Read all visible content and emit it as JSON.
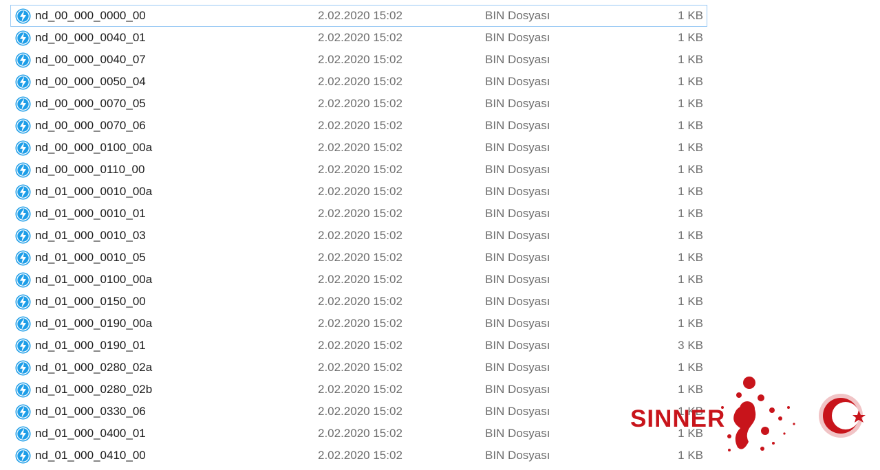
{
  "file_list": {
    "selected_index": 0,
    "file_icon": "lightning-file-icon",
    "rows": [
      {
        "name": "nd_00_000_0000_00",
        "date": "2.02.2020 15:02",
        "type": "BIN Dosyası",
        "size": "1 KB"
      },
      {
        "name": "nd_00_000_0040_01",
        "date": "2.02.2020 15:02",
        "type": "BIN Dosyası",
        "size": "1 KB"
      },
      {
        "name": "nd_00_000_0040_07",
        "date": "2.02.2020 15:02",
        "type": "BIN Dosyası",
        "size": "1 KB"
      },
      {
        "name": "nd_00_000_0050_04",
        "date": "2.02.2020 15:02",
        "type": "BIN Dosyası",
        "size": "1 KB"
      },
      {
        "name": "nd_00_000_0070_05",
        "date": "2.02.2020 15:02",
        "type": "BIN Dosyası",
        "size": "1 KB"
      },
      {
        "name": "nd_00_000_0070_06",
        "date": "2.02.2020 15:02",
        "type": "BIN Dosyası",
        "size": "1 KB"
      },
      {
        "name": "nd_00_000_0100_00a",
        "date": "2.02.2020 15:02",
        "type": "BIN Dosyası",
        "size": "1 KB"
      },
      {
        "name": "nd_00_000_0110_00",
        "date": "2.02.2020 15:02",
        "type": "BIN Dosyası",
        "size": "1 KB"
      },
      {
        "name": "nd_01_000_0010_00a",
        "date": "2.02.2020 15:02",
        "type": "BIN Dosyası",
        "size": "1 KB"
      },
      {
        "name": "nd_01_000_0010_01",
        "date": "2.02.2020 15:02",
        "type": "BIN Dosyası",
        "size": "1 KB"
      },
      {
        "name": "nd_01_000_0010_03",
        "date": "2.02.2020 15:02",
        "type": "BIN Dosyası",
        "size": "1 KB"
      },
      {
        "name": "nd_01_000_0010_05",
        "date": "2.02.2020 15:02",
        "type": "BIN Dosyası",
        "size": "1 KB"
      },
      {
        "name": "nd_01_000_0100_00a",
        "date": "2.02.2020 15:02",
        "type": "BIN Dosyası",
        "size": "1 KB"
      },
      {
        "name": "nd_01_000_0150_00",
        "date": "2.02.2020 15:02",
        "type": "BIN Dosyası",
        "size": "1 KB"
      },
      {
        "name": "nd_01_000_0190_00a",
        "date": "2.02.2020 15:02",
        "type": "BIN Dosyası",
        "size": "1 KB"
      },
      {
        "name": "nd_01_000_0190_01",
        "date": "2.02.2020 15:02",
        "type": "BIN Dosyası",
        "size": "3 KB"
      },
      {
        "name": "nd_01_000_0280_02a",
        "date": "2.02.2020 15:02",
        "type": "BIN Dosyası",
        "size": "1 KB"
      },
      {
        "name": "nd_01_000_0280_02b",
        "date": "2.02.2020 15:02",
        "type": "BIN Dosyası",
        "size": "1 KB"
      },
      {
        "name": "nd_01_000_0330_06",
        "date": "2.02.2020 15:02",
        "type": "BIN Dosyası",
        "size": "1 KB"
      },
      {
        "name": "nd_01_000_0400_01",
        "date": "2.02.2020 15:02",
        "type": "BIN Dosyası",
        "size": "1 KB"
      },
      {
        "name": "nd_01_000_0410_00",
        "date": "2.02.2020 15:02",
        "type": "BIN Dosyası",
        "size": "1 KB"
      }
    ]
  },
  "watermark": {
    "text": "SINNER",
    "icon": "blood-splatter-crescent-star-logo",
    "color": "#c8141b"
  },
  "colors": {
    "icon_blue": "#1e9ee8",
    "selection_border": "#99c9f4",
    "name_text": "#1a1a1a",
    "detail_text": "#6d6d6d"
  }
}
